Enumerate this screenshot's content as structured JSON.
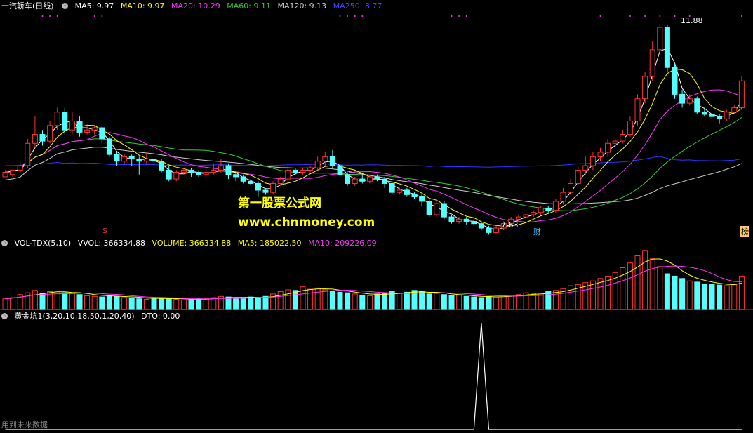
{
  "price_header": {
    "stock_name": "一汽轿车(日线)",
    "ma5": "MA5: 9.97",
    "ma10": "MA10: 9.97",
    "ma20": "MA20: 10.29",
    "ma60": "MA60: 9.11",
    "ma120": "MA120: 9.13",
    "ma250": "MA250: 8.77"
  },
  "annotations": {
    "high_label": "11.88",
    "low_label": "7.63",
    "marker_s": "$",
    "marker_cai": "财",
    "marker_bang": "榜"
  },
  "watermark": {
    "title": "第一股票公式网",
    "url": "www.chnmoney.com"
  },
  "vol_header": {
    "name": "VOL-TDX(5,10)",
    "vvol": "VVOL: 366334.88",
    "volume": "VOLUME: 366334.88",
    "ma5": "MA5: 185022.50",
    "ma10": "MA10: 209226.09"
  },
  "dto_header": {
    "name": "黄金坑1(3,20,10,18,50,1,20,40)",
    "dto": "DTO: 0.00"
  },
  "footer_note": "用到未来数据",
  "colors": {
    "up": "#ff3333",
    "down": "#54ffff",
    "ma5": "#ffffff",
    "ma10": "#ffff00",
    "ma20": "#ff33ff",
    "ma60": "#33cc33",
    "ma120": "#cccccc",
    "ma250": "#3333ff",
    "border": "#aa0000"
  },
  "chart_data": {
    "type": "candlestick",
    "price_range": [
      7.3,
      12.1
    ],
    "candles": [
      [
        8.45,
        8.55,
        8.5,
        8.6
      ],
      [
        8.5,
        8.6,
        8.45,
        8.62
      ],
      [
        8.6,
        8.7,
        8.55,
        8.8
      ],
      [
        8.7,
        9.2,
        8.65,
        9.3
      ],
      [
        9.2,
        9.4,
        9.1,
        9.8
      ],
      [
        9.4,
        9.25,
        9.15,
        9.5
      ],
      [
        9.25,
        9.6,
        9.2,
        9.7
      ],
      [
        9.6,
        9.9,
        9.5,
        10.0
      ],
      [
        9.9,
        9.5,
        9.4,
        10.0
      ],
      [
        9.5,
        9.7,
        9.4,
        9.9
      ],
      [
        9.7,
        9.45,
        9.35,
        9.8
      ],
      [
        9.45,
        9.5,
        9.4,
        9.6
      ],
      [
        9.5,
        9.55,
        9.4,
        9.6
      ],
      [
        9.55,
        9.3,
        9.2,
        9.6
      ],
      [
        9.3,
        8.95,
        8.9,
        9.35
      ],
      [
        8.95,
        8.8,
        8.7,
        9.0
      ],
      [
        8.8,
        8.9,
        8.75,
        8.95
      ],
      [
        8.9,
        8.85,
        8.7,
        8.95
      ],
      [
        8.85,
        8.8,
        8.5,
        8.9
      ],
      [
        8.8,
        8.85,
        8.75,
        8.95
      ],
      [
        8.85,
        8.8,
        8.7,
        8.9
      ],
      [
        8.8,
        8.6,
        8.55,
        8.85
      ],
      [
        8.6,
        8.4,
        8.35,
        8.7
      ],
      [
        8.4,
        8.55,
        8.35,
        8.6
      ],
      [
        8.55,
        8.6,
        8.5,
        8.65
      ],
      [
        8.6,
        8.55,
        8.45,
        8.65
      ],
      [
        8.55,
        8.5,
        8.45,
        8.6
      ],
      [
        8.5,
        8.55,
        8.45,
        8.6
      ],
      [
        8.55,
        8.6,
        8.5,
        8.75
      ],
      [
        8.6,
        8.7,
        8.55,
        8.85
      ],
      [
        8.7,
        8.5,
        8.4,
        8.75
      ],
      [
        8.5,
        8.45,
        8.35,
        8.55
      ],
      [
        8.45,
        8.35,
        8.3,
        8.5
      ],
      [
        8.35,
        8.3,
        8.25,
        8.4
      ],
      [
        8.3,
        8.15,
        8.0,
        8.35
      ],
      [
        8.15,
        8.1,
        8.05,
        8.2
      ],
      [
        8.1,
        8.3,
        8.05,
        8.35
      ],
      [
        8.3,
        8.4,
        8.25,
        8.45
      ],
      [
        8.4,
        8.6,
        8.35,
        8.7
      ],
      [
        8.6,
        8.55,
        8.5,
        8.65
      ],
      [
        8.55,
        8.6,
        8.5,
        8.65
      ],
      [
        8.6,
        8.65,
        8.55,
        8.7
      ],
      [
        8.65,
        8.8,
        8.6,
        8.9
      ],
      [
        8.8,
        8.9,
        8.7,
        9.0
      ],
      [
        8.9,
        8.7,
        8.65,
        9.05
      ],
      [
        8.7,
        8.5,
        8.4,
        8.75
      ],
      [
        8.5,
        8.3,
        8.25,
        8.55
      ],
      [
        8.3,
        8.4,
        8.25,
        8.45
      ],
      [
        8.4,
        8.35,
        8.3,
        8.5
      ],
      [
        8.35,
        8.45,
        8.3,
        8.5
      ],
      [
        8.45,
        8.4,
        8.35,
        8.5
      ],
      [
        8.4,
        8.3,
        8.2,
        8.45
      ],
      [
        8.3,
        8.1,
        8.05,
        8.35
      ],
      [
        8.1,
        8.15,
        8.05,
        8.2
      ],
      [
        8.15,
        8.05,
        8.0,
        8.2
      ],
      [
        8.05,
        8.0,
        7.95,
        8.1
      ],
      [
        8.0,
        7.9,
        7.8,
        8.05
      ],
      [
        7.9,
        7.6,
        7.55,
        7.95
      ],
      [
        7.6,
        7.85,
        7.55,
        7.9
      ],
      [
        7.85,
        7.55,
        7.5,
        7.9
      ],
      [
        7.55,
        7.45,
        7.4,
        7.6
      ],
      [
        7.45,
        7.5,
        7.4,
        7.55
      ],
      [
        7.5,
        7.45,
        7.38,
        7.55
      ],
      [
        7.45,
        7.4,
        7.35,
        7.5
      ],
      [
        7.4,
        7.3,
        7.25,
        7.45
      ],
      [
        7.3,
        7.2,
        7.15,
        7.35
      ],
      [
        7.2,
        7.3,
        7.18,
        7.35
      ],
      [
        7.3,
        7.4,
        7.25,
        7.45
      ],
      [
        7.4,
        7.5,
        7.35,
        7.55
      ],
      [
        7.5,
        7.55,
        7.45,
        7.6
      ],
      [
        7.55,
        7.6,
        7.5,
        7.65
      ],
      [
        7.6,
        7.65,
        7.55,
        7.7
      ],
      [
        7.65,
        7.75,
        7.6,
        7.8
      ],
      [
        7.75,
        7.7,
        7.65,
        7.8
      ],
      [
        7.7,
        7.9,
        7.65,
        7.95
      ],
      [
        7.9,
        8.1,
        7.85,
        8.2
      ],
      [
        8.1,
        8.3,
        8.05,
        8.4
      ],
      [
        8.3,
        8.6,
        8.25,
        8.7
      ],
      [
        8.6,
        8.7,
        8.5,
        8.9
      ],
      [
        8.7,
        8.9,
        8.6,
        9.0
      ],
      [
        8.9,
        9.0,
        8.8,
        9.1
      ],
      [
        9.0,
        9.2,
        8.9,
        9.3
      ],
      [
        9.2,
        9.25,
        9.1,
        9.3
      ],
      [
        9.25,
        9.4,
        9.2,
        9.5
      ],
      [
        9.4,
        9.7,
        9.35,
        9.8
      ],
      [
        9.7,
        10.2,
        9.6,
        10.3
      ],
      [
        10.2,
        10.7,
        10.1,
        10.8
      ],
      [
        10.7,
        11.3,
        10.6,
        11.5
      ],
      [
        11.3,
        11.8,
        11.2,
        11.88
      ],
      [
        11.8,
        10.9,
        10.8,
        11.85
      ],
      [
        10.9,
        10.3,
        10.2,
        11.0
      ],
      [
        10.3,
        10.1,
        10.0,
        10.4
      ],
      [
        10.1,
        10.2,
        10.05,
        10.3
      ],
      [
        10.2,
        9.9,
        9.85,
        10.25
      ],
      [
        9.9,
        9.85,
        9.8,
        10.0
      ],
      [
        9.85,
        9.8,
        9.7,
        9.9
      ],
      [
        9.8,
        9.75,
        9.65,
        9.85
      ],
      [
        9.75,
        9.9,
        9.7,
        9.95
      ],
      [
        9.9,
        10.0,
        9.85,
        10.05
      ],
      [
        10.0,
        10.6,
        9.95,
        10.7
      ]
    ],
    "volume_range": [
      0,
      1000
    ],
    "volume": [
      180,
      200,
      250,
      280,
      320,
      270,
      300,
      310,
      280,
      270,
      250,
      230,
      220,
      210,
      240,
      220,
      200,
      190,
      180,
      170,
      200,
      190,
      180,
      170,
      160,
      170,
      180,
      190,
      200,
      220,
      210,
      200,
      190,
      210,
      200,
      220,
      260,
      300,
      330,
      320,
      380,
      340,
      360,
      330,
      300,
      290,
      280,
      260,
      240,
      230,
      260,
      280,
      300,
      270,
      290,
      320,
      300,
      260,
      270,
      250,
      230,
      240,
      220,
      210,
      200,
      220,
      210,
      230,
      240,
      250,
      280,
      270,
      260,
      300,
      320,
      350,
      400,
      420,
      450,
      480,
      520,
      560,
      620,
      700,
      780,
      900,
      990,
      850,
      720,
      600,
      560,
      520,
      480,
      460,
      430,
      420,
      410,
      400,
      420,
      560
    ],
    "dto_range": [
      0,
      100
    ],
    "dto_peak_index": 64,
    "dto_peak_value": 100
  }
}
